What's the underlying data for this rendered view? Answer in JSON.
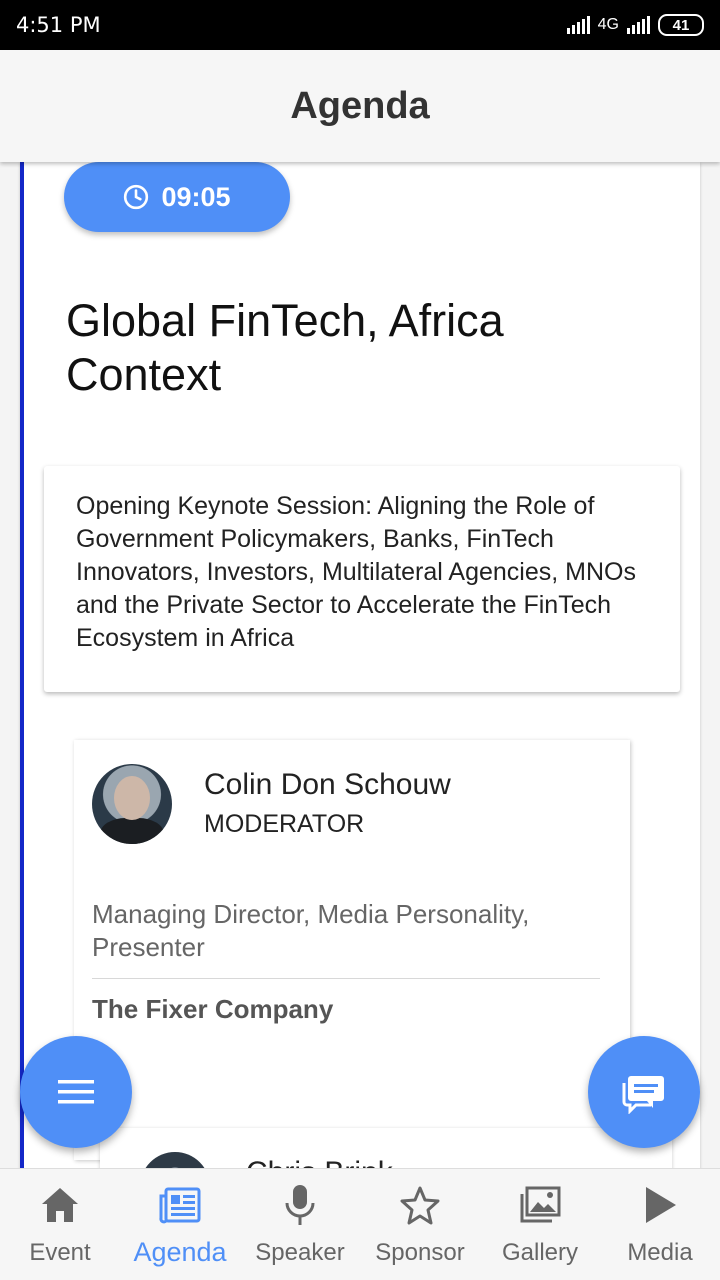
{
  "status_bar": {
    "time": "4:51 PM",
    "network": "4G",
    "battery": "41"
  },
  "app_bar": {
    "title": "Agenda"
  },
  "session": {
    "time": "09:05",
    "title": "Global FinTech, Africa Context",
    "description": "Opening Keynote Session: Aligning the Role of Government Policymakers, Banks, FinTech Innovators, Investors, Multilateral Agencies, MNOs and the Private Sector to Accelerate the FinTech Ecosystem in Africa"
  },
  "speaker": {
    "name": "Colin Don Schouw",
    "role": "MODERATOR",
    "position": "Managing Director, Media Personality, Presenter",
    "company": "The Fixer Company"
  },
  "next_speaker": {
    "name": "Chris Brink"
  },
  "bottom_nav": {
    "items": [
      {
        "label": "Event",
        "icon": "home-icon"
      },
      {
        "label": "Agenda",
        "icon": "newspaper-icon",
        "active": true
      },
      {
        "label": "Speaker",
        "icon": "microphone-icon"
      },
      {
        "label": "Sponsor",
        "icon": "star-icon"
      },
      {
        "label": "Gallery",
        "icon": "gallery-icon"
      },
      {
        "label": "Media",
        "icon": "play-icon"
      }
    ]
  },
  "colors": {
    "accent": "#4f8ff7",
    "timeline": "#1428c8",
    "nav_inactive": "#666666"
  }
}
